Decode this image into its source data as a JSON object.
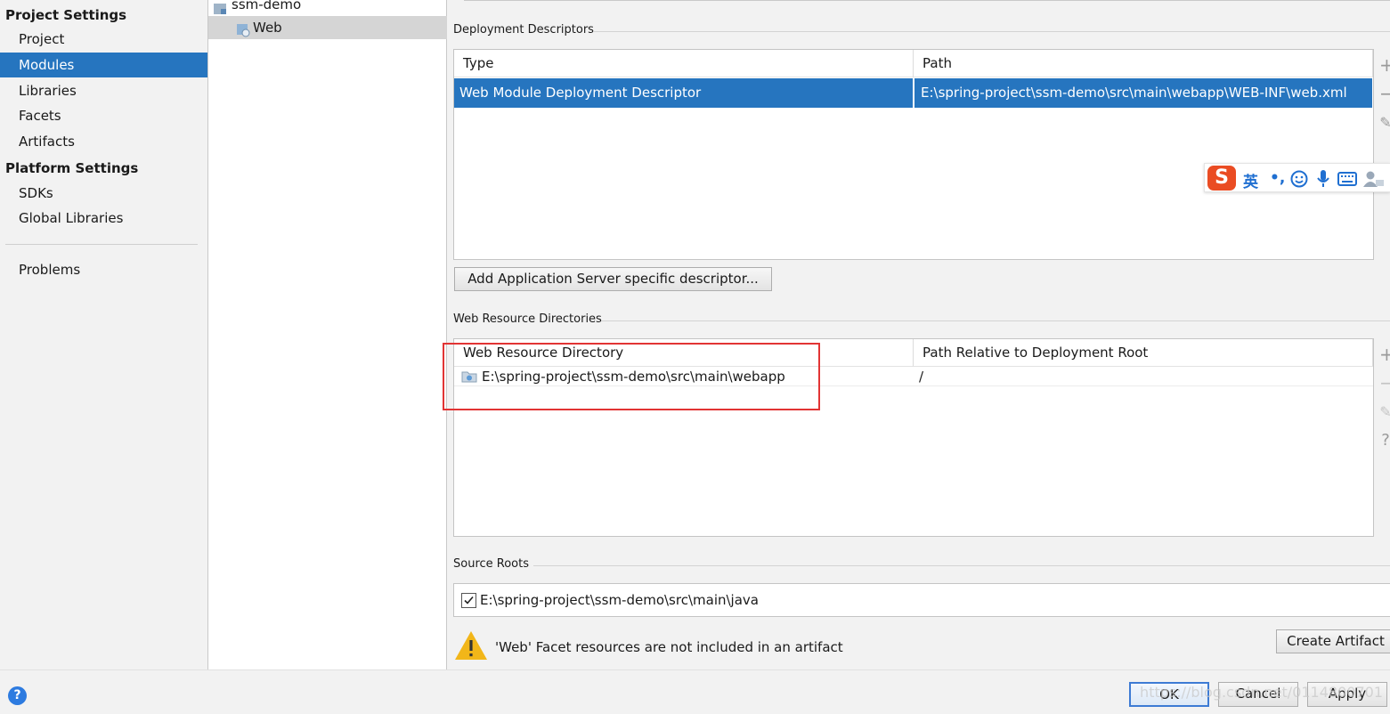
{
  "sidebar": {
    "project_settings_title": "Project Settings",
    "project_items": [
      "Project",
      "Modules",
      "Libraries",
      "Facets",
      "Artifacts"
    ],
    "selected_item": "Modules",
    "platform_settings_title": "Platform Settings",
    "platform_items": [
      "SDKs",
      "Global Libraries"
    ],
    "problems_label": "Problems"
  },
  "tree": {
    "module_name": "ssm-demo",
    "facet_name": "Web"
  },
  "deployment_descriptors": {
    "title": "Deployment Descriptors",
    "columns": [
      "Type",
      "Path"
    ],
    "rows": [
      {
        "type": "Web Module Deployment Descriptor",
        "path": "E:\\spring-project\\ssm-demo\\src\\main\\webapp\\WEB-INF\\web.xml"
      }
    ],
    "add_button_label": "Add Application Server specific descriptor..."
  },
  "web_resource_directories": {
    "title": "Web Resource Directories",
    "columns": [
      "Web Resource Directory",
      "Path Relative to Deployment Root"
    ],
    "rows": [
      {
        "directory": "E:\\spring-project\\ssm-demo\\src\\main\\webapp",
        "relative_path": "/"
      }
    ]
  },
  "source_roots": {
    "title": "Source Roots",
    "items": [
      {
        "path": "E:\\spring-project\\ssm-demo\\src\\main\\java",
        "checked": true
      }
    ]
  },
  "warning": {
    "message": "'Web' Facet resources are not included in an artifact",
    "create_artifact_label": "Create Artifact"
  },
  "ime_toolbar": {
    "logo": "S",
    "mode": "英",
    "punct": "•,",
    "icons": [
      "smiley-icon",
      "microphone-icon",
      "keyboard-icon",
      "user-icon"
    ]
  },
  "footer": {
    "help": "?",
    "ok_label": "OK",
    "cancel_label": "Cancel",
    "apply_label": "Apply"
  },
  "watermark": "https://blog.csdn.net/0114800701",
  "colors": {
    "selection": "#2675bf",
    "annotation_red": "#e23434",
    "warning_yellow": "#f2b619",
    "help_blue": "#2d7be0"
  }
}
